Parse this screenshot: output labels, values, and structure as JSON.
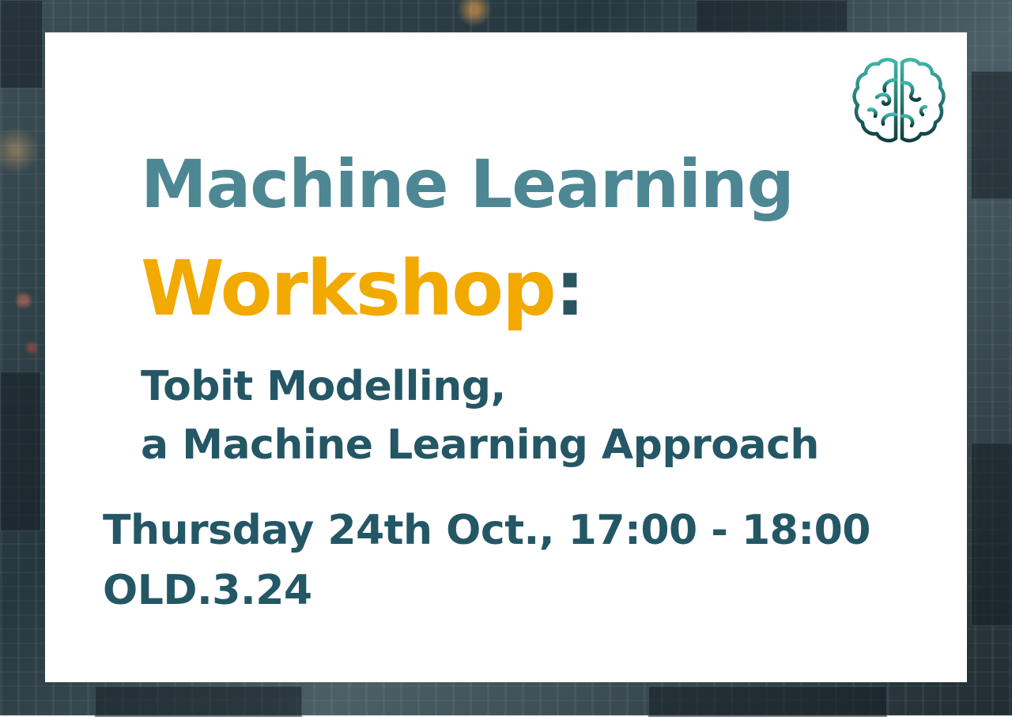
{
  "title": {
    "line1": "Machine Learning",
    "line2_word": "Workshop",
    "line2_punct": ":"
  },
  "subtitle": {
    "line1": "Tobit Modelling,",
    "line2": "a Machine Learning Approach"
  },
  "event": {
    "datetime": "Thursday 24th Oct., 17:00 - 18:00",
    "room": "OLD.3.24"
  },
  "logo": {
    "icon": "brain-icon"
  },
  "colors": {
    "title": "#4e8794",
    "accent": "#f2a900",
    "text": "#245765",
    "logo_start": "#3fb6a8",
    "logo_end": "#0f3d42",
    "card": "#ffffff"
  }
}
